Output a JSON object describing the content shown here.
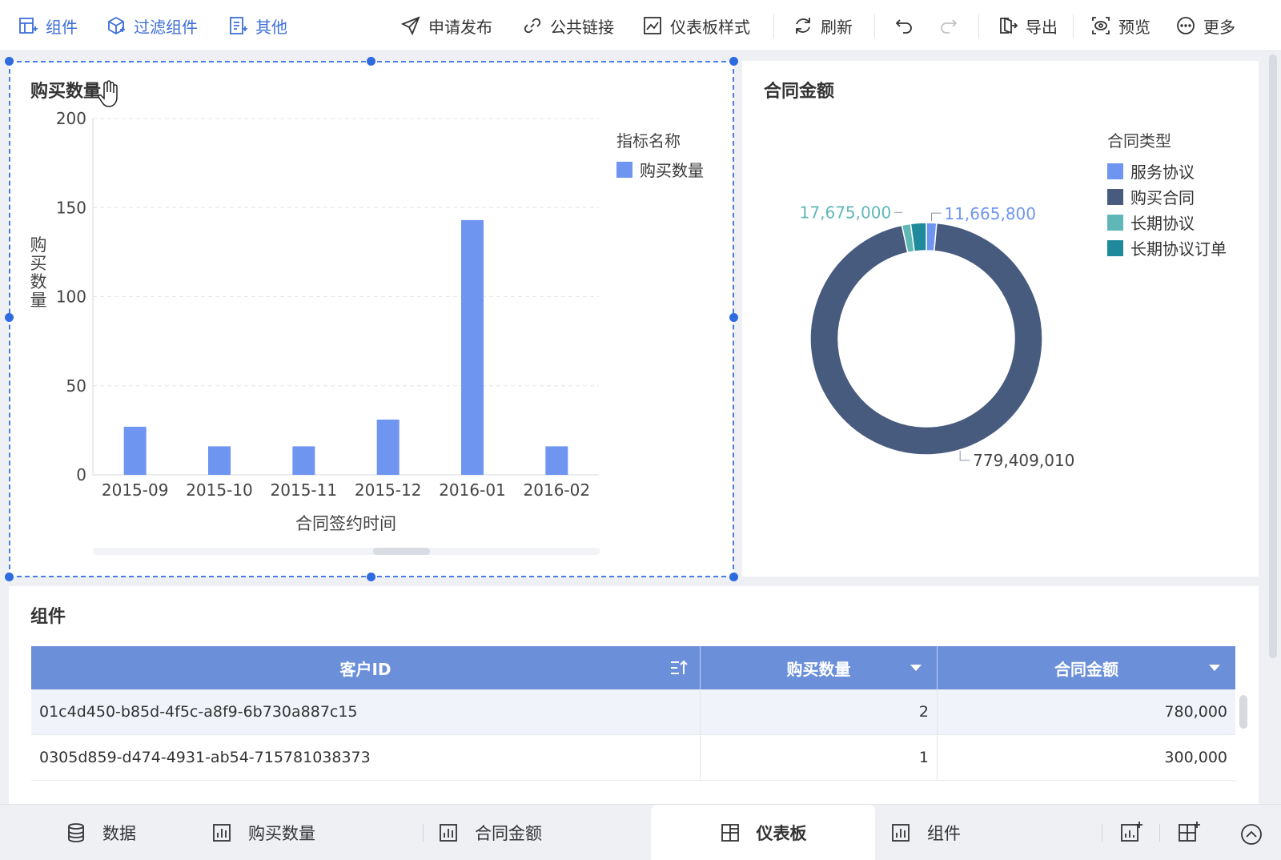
{
  "toolbar": {
    "left": [
      {
        "label": "组件",
        "icon": "add-component-icon"
      },
      {
        "label": "过滤组件",
        "icon": "filter-component-icon"
      },
      {
        "label": "其他",
        "icon": "other-icon"
      }
    ],
    "right": {
      "publish": "申请发布",
      "public_link": "公共链接",
      "dashboard_style": "仪表板样式",
      "refresh": "刷新",
      "export": "导出",
      "preview": "预览",
      "more": "更多"
    }
  },
  "bar_panel": {
    "title": "购买数量",
    "legend_title": "指标名称",
    "legend_item": "购买数量"
  },
  "donut_panel": {
    "title": "合同金额",
    "legend_title": "合同类型",
    "legend": [
      {
        "label": "服务协议",
        "color": "#6e95f0"
      },
      {
        "label": "购买合同",
        "color": "#475b7e"
      },
      {
        "label": "长期协议",
        "color": "#5fb8b6"
      },
      {
        "label": "长期协议订单",
        "color": "#1f8a9c"
      }
    ],
    "labels": {
      "service": "11,665,800",
      "long_term": "17,675,000",
      "purchase": "779,409,010"
    }
  },
  "table_panel": {
    "title": "组件",
    "headers": [
      "客户ID",
      "购买数量",
      "合同金额"
    ],
    "rows": [
      [
        "01c4d450-b85d-4f5c-a8f9-6b730a887c15",
        "2",
        "780,000"
      ],
      [
        "0305d859-d474-4931-ab54-715781038373",
        "1",
        "300,000"
      ]
    ]
  },
  "tabs": [
    {
      "label": "数据",
      "icon": "database-icon"
    },
    {
      "label": "购买数量",
      "icon": "bar-chart-icon"
    },
    {
      "label": "合同金额",
      "icon": "bar-chart-icon"
    },
    {
      "label": "仪表板",
      "icon": "dashboard-icon",
      "active": true
    },
    {
      "label": "组件",
      "icon": "bar-chart-icon"
    }
  ],
  "chart_data": [
    {
      "type": "bar",
      "title": "购买数量",
      "xlabel": "合同签约时间",
      "ylabel": "购买数量",
      "categories": [
        "2015-09",
        "2015-10",
        "2015-11",
        "2015-12",
        "2016-01",
        "2016-02"
      ],
      "series": [
        {
          "name": "购买数量",
          "values": [
            27,
            16,
            16,
            31,
            143,
            16
          ],
          "color": "#6e95f0"
        }
      ],
      "yticks": [
        0,
        50,
        100,
        150,
        200
      ],
      "ylim": [
        0,
        200
      ],
      "grid": true,
      "legend": "top-right"
    },
    {
      "type": "pie",
      "title": "合同金额",
      "donut": true,
      "slices": [
        {
          "name": "服务协议",
          "value": 11665800,
          "color": "#6e95f0"
        },
        {
          "name": "购买合同",
          "value": 779409010,
          "color": "#475b7e"
        },
        {
          "name": "长期协议",
          "value": 10000000,
          "color": "#5fb8b6"
        },
        {
          "name": "长期协议订单",
          "value": 17675000,
          "color": "#1f8a9c"
        }
      ],
      "legend": "top-right"
    }
  ]
}
